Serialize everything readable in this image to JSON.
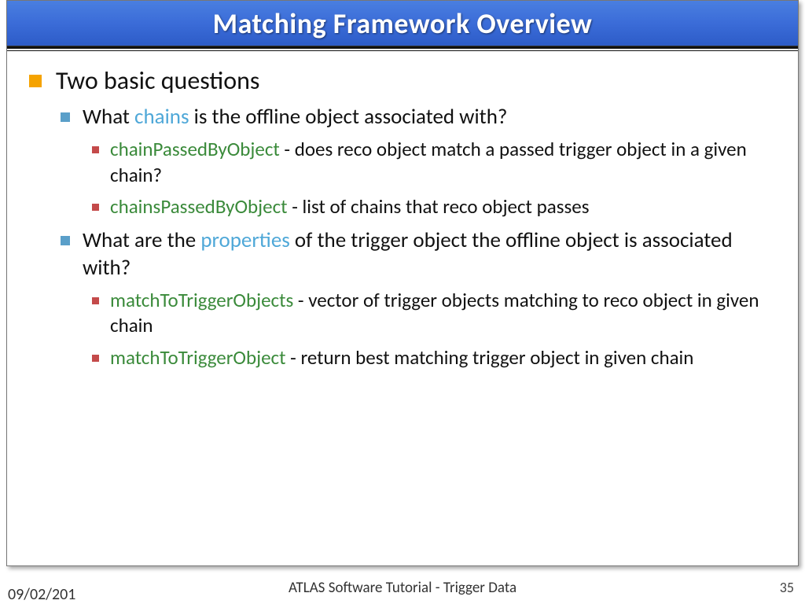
{
  "title": "Matching Framework Overview",
  "content": {
    "heading": "Two basic questions",
    "q1": {
      "prefix": "What ",
      "highlight": "chains",
      "suffix": " is the offline object associated with?",
      "items": [
        {
          "code": "chainPassedByObject",
          "desc": " - does reco object match a passed trigger object in a given chain?"
        },
        {
          "code": "chainsPassedByObject",
          "desc": " - list of chains that reco object passes"
        }
      ]
    },
    "q2": {
      "prefix": "What are the ",
      "highlight": "properties",
      "suffix": " of the trigger object the offline object is associated with?",
      "items": [
        {
          "code": "matchToTriggerObjects",
          "desc": " - vector of trigger objects matching to reco object in given chain"
        },
        {
          "code": "matchToTriggerObject",
          "desc": " - return best matching trigger object in given chain"
        }
      ]
    }
  },
  "footer": {
    "date": "09/02/201",
    "center": "ATLAS Software Tutorial - Trigger Data",
    "page": "35"
  }
}
